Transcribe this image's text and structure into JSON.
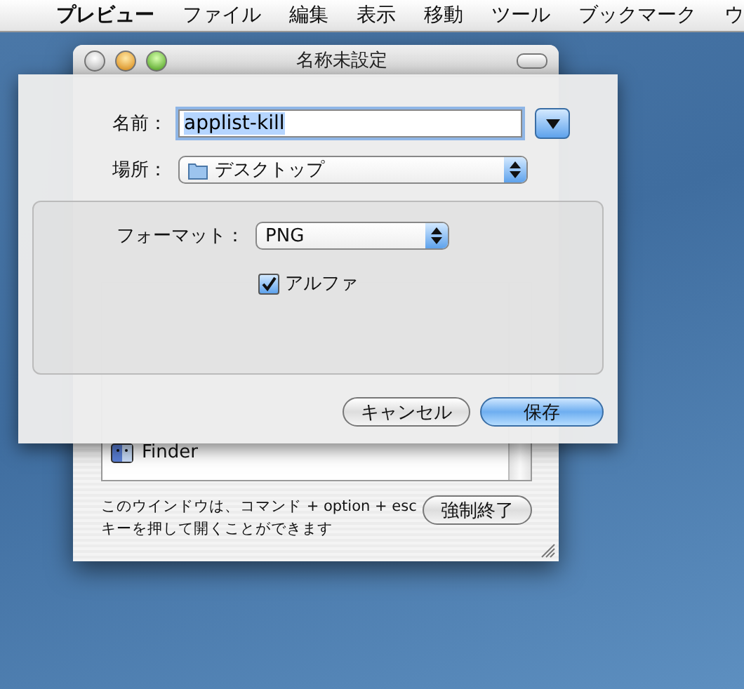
{
  "menu_bar": {
    "items": [
      {
        "label": "プレビュー"
      },
      {
        "label": "ファイル"
      },
      {
        "label": "編集"
      },
      {
        "label": "表示"
      },
      {
        "label": "移動"
      },
      {
        "label": "ツール"
      },
      {
        "label": "ブックマーク"
      },
      {
        "label": "ウ"
      }
    ]
  },
  "window": {
    "title": "名称未設定"
  },
  "app_list": {
    "items": [
      {
        "name": "Finder"
      }
    ]
  },
  "note": "このウインドウは、コマンド + option + esc\nキーを押して開くことができます",
  "force_quit_button": "強制終了",
  "save_sheet": {
    "name_label": "名前：",
    "name_value": "applist-kill",
    "name_text_selected": true,
    "where_label": "場所：",
    "where_value": "デスクトップ",
    "format_label": "フォーマット：",
    "format_value": "PNG",
    "alpha": {
      "label": "アルファ",
      "checked": true
    },
    "buttons": [
      {
        "label": "キャンセル",
        "default": false
      },
      {
        "label": "保存",
        "default": true
      }
    ]
  }
}
